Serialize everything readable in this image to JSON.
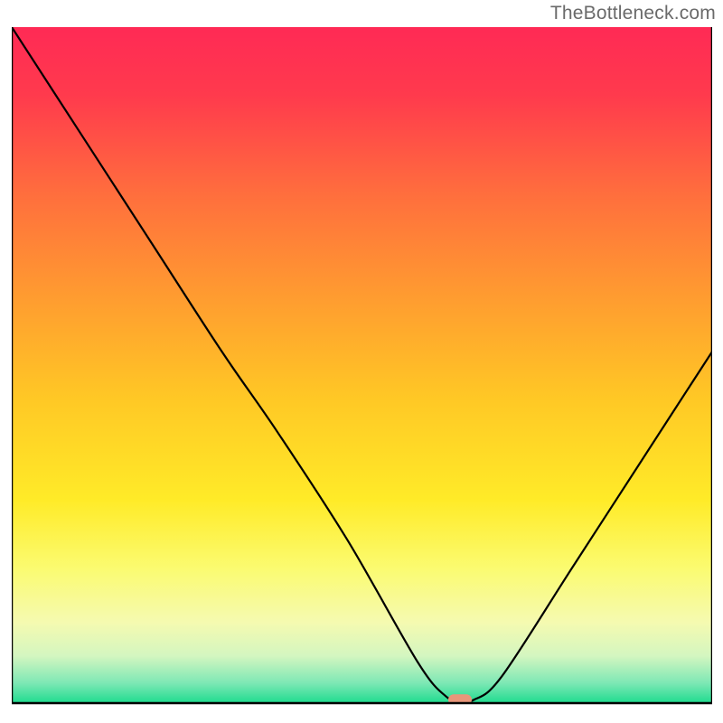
{
  "watermark": "TheBottleneck.com",
  "chart_data": {
    "type": "line",
    "title": "",
    "xlabel": "",
    "ylabel": "",
    "xlim": [
      0,
      100
    ],
    "ylim": [
      0,
      100
    ],
    "grid": false,
    "series": [
      {
        "name": "curve",
        "color": "#000000",
        "x": [
          0,
          10,
          20,
          30,
          38,
          48,
          58,
          62,
          64,
          66,
          70,
          80,
          90,
          100
        ],
        "y": [
          100,
          84,
          68,
          52,
          40,
          24,
          6,
          1,
          0.5,
          0.5,
          4,
          20,
          36,
          52
        ]
      }
    ],
    "marker": {
      "x": 64,
      "y": 0.5,
      "color": "#E9967A",
      "shape": "capsule"
    },
    "gradient_stops": [
      {
        "offset": 0.0,
        "color": "#FF2A55"
      },
      {
        "offset": 0.1,
        "color": "#FF3A4D"
      },
      {
        "offset": 0.25,
        "color": "#FF6F3D"
      },
      {
        "offset": 0.4,
        "color": "#FF9C30"
      },
      {
        "offset": 0.55,
        "color": "#FFC825"
      },
      {
        "offset": 0.7,
        "color": "#FFEB28"
      },
      {
        "offset": 0.8,
        "color": "#FBFB70"
      },
      {
        "offset": 0.88,
        "color": "#F5FAB0"
      },
      {
        "offset": 0.93,
        "color": "#D4F6C0"
      },
      {
        "offset": 0.97,
        "color": "#7EE8B5"
      },
      {
        "offset": 1.0,
        "color": "#1FDB8F"
      }
    ]
  }
}
